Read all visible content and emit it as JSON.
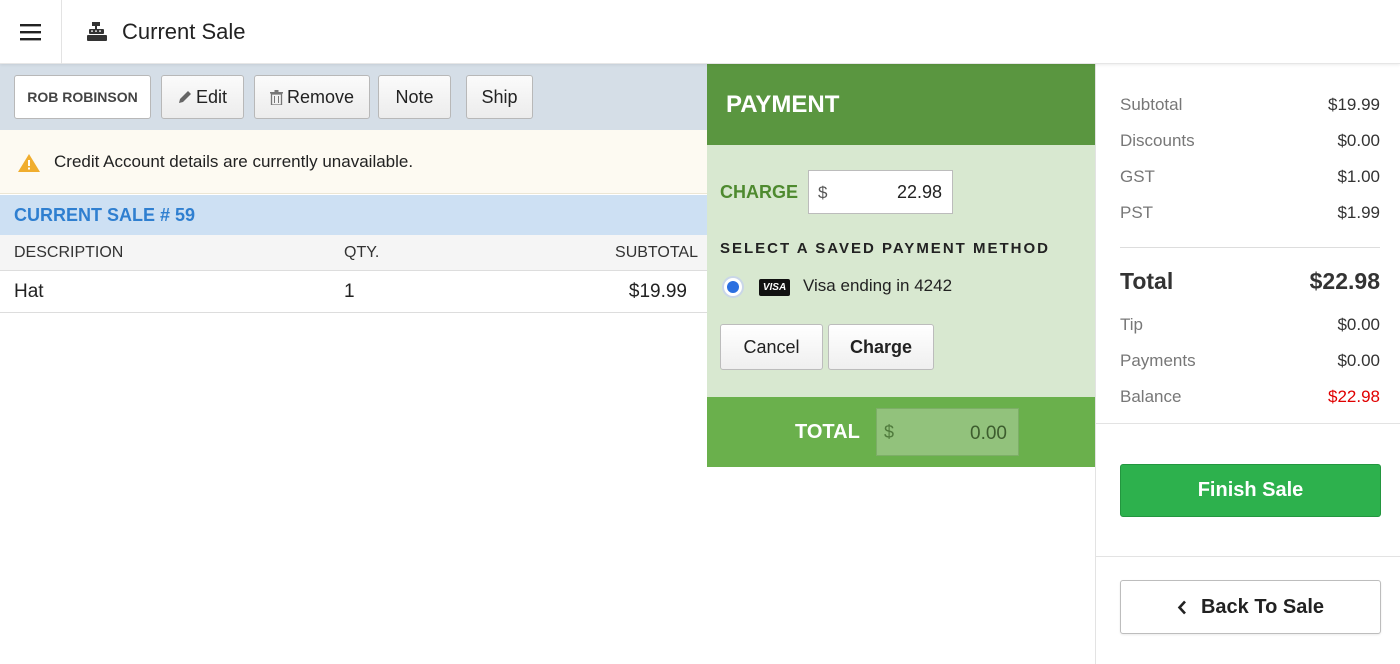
{
  "header": {
    "title": "Current Sale"
  },
  "toolbar": {
    "customer_label": "ROB ROBINSON",
    "edit_label": "Edit",
    "remove_label": "Remove",
    "note_label": "Note",
    "ship_label": "Ship"
  },
  "alert": {
    "message": "Credit Account details are currently unavailable."
  },
  "sale": {
    "title": "CURRENT SALE # 59",
    "columns": {
      "description": "DESCRIPTION",
      "qty": "QTY.",
      "subtotal": "SUBTOTAL"
    },
    "lines": [
      {
        "description": "Hat",
        "qty": "1",
        "subtotal": "$19.99"
      }
    ]
  },
  "payment": {
    "title": "PAYMENT",
    "charge_label": "CHARGE",
    "currency_symbol": "$",
    "charge_amount": "22.98",
    "saved_method_label": "SELECT A SAVED PAYMENT METHOD",
    "card_brand": "VISA",
    "card_label": "Visa ending in 4242",
    "card_selected": true,
    "cancel_label": "Cancel",
    "charge_button_label": "Charge",
    "total_label": "TOTAL",
    "total_amount": "0.00"
  },
  "summary": {
    "subtotal_label": "Subtotal",
    "subtotal_value": "$19.99",
    "discounts_label": "Discounts",
    "discounts_value": "$0.00",
    "gst_label": "GST",
    "gst_value": "$1.00",
    "pst_label": "PST",
    "pst_value": "$1.99",
    "total_label": "Total",
    "total_value": "$22.98",
    "tip_label": "Tip",
    "tip_value": "$0.00",
    "payments_label": "Payments",
    "payments_value": "$0.00",
    "balance_label": "Balance",
    "balance_value": "$22.98",
    "finish_label": "Finish Sale",
    "back_label": "Back To Sale"
  },
  "colors": {
    "payment_header": "#5a9640",
    "payment_body": "#d8e8d0",
    "payment_total_bar": "#6ab04c",
    "finish_button": "#2db14d",
    "balance_due": "#e00000",
    "sale_title": "#2f7fd0",
    "alert_icon": "#f0ad2e"
  },
  "icons": {
    "menu": "hamburger-menu-icon",
    "register": "cash-register-icon",
    "edit": "pencil-icon",
    "remove": "trash-icon",
    "alert": "warning-icon",
    "back": "chevron-left-icon"
  }
}
